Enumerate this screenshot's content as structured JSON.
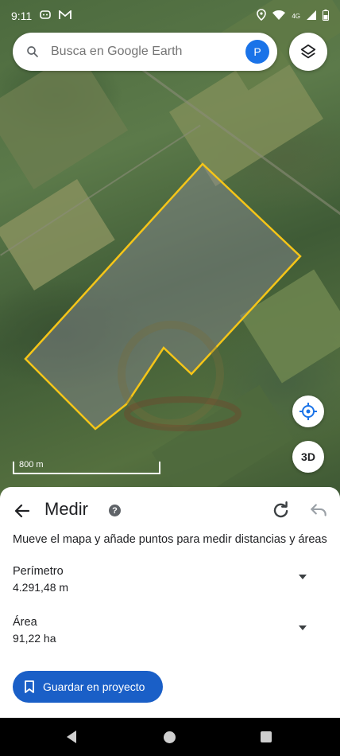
{
  "status_bar": {
    "time": "9:11",
    "icons_left": [
      "chat-icon",
      "gmail-icon"
    ],
    "icons_right": [
      "location-icon",
      "wifi-icon",
      "network-4g-icon",
      "signal-icon",
      "battery-icon"
    ],
    "network_label": "4G"
  },
  "search": {
    "placeholder": "Busca en Google Earth",
    "avatar_letter": "P"
  },
  "map": {
    "scale_label": "800 m",
    "button_3d": "3D",
    "polygon_color": "#f5c518"
  },
  "sheet": {
    "title": "Medir",
    "instructions": "Mueve el mapa y añade puntos para medir distancias y áreas",
    "perimeter_label": "Perímetro",
    "perimeter_value": "4.291,48 m",
    "area_label": "Área",
    "area_value": "91,22 ha",
    "save_label": "Guardar en proyecto"
  },
  "colors": {
    "accent": "#1a73e8",
    "save_button": "#1a5fc7"
  }
}
